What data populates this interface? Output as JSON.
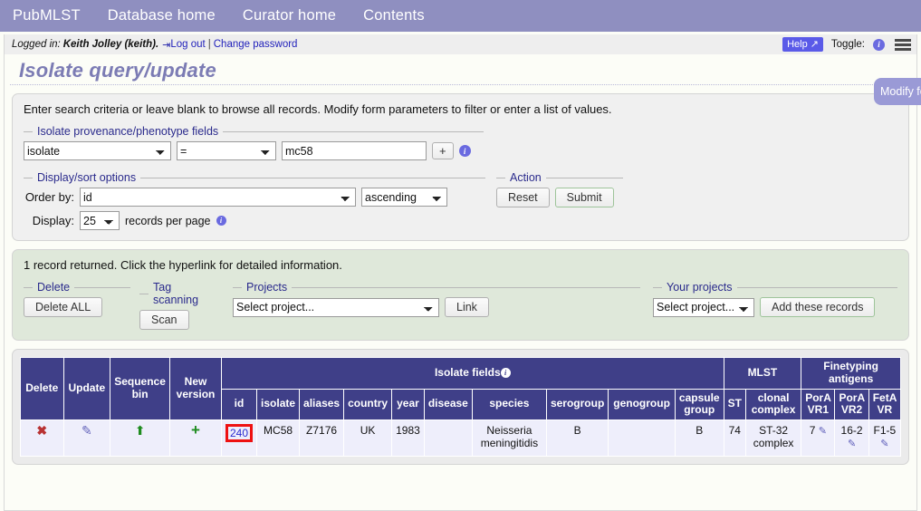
{
  "navbar": {
    "items": [
      {
        "label": "PubMLST"
      },
      {
        "label": "Database home"
      },
      {
        "label": "Curator home"
      },
      {
        "label": "Contents"
      }
    ]
  },
  "loginbar": {
    "prefix": "Logged in:",
    "user": "Keith Jolley (keith).",
    "logout": "Log out",
    "separator": "|",
    "change_password": "Change password",
    "help_label": "Help",
    "help_external_icon": "↗",
    "toggle_label": "Toggle:",
    "info_glyph": "i",
    "menu_icon": "hamburger-icon"
  },
  "page": {
    "title": "Isolate query/update"
  },
  "query_form": {
    "intro": "Enter search criteria or leave blank to browse all records. Modify form parameters to filter or enter a list of values.",
    "provenance": {
      "legend": "Isolate provenance/phenotype fields",
      "field_value": "isolate",
      "operator_value": "=",
      "search_value": "mc58",
      "search_placeholder": "",
      "add_button": "+",
      "info_glyph": "i"
    },
    "display": {
      "legend": "Display/sort options",
      "order_by_label": "Order by:",
      "order_by_value": "id",
      "direction_value": "ascending",
      "display_label": "Display:",
      "display_value": "25",
      "records_per_page": "records per page",
      "info_glyph": "i"
    },
    "action": {
      "legend": "Action",
      "reset_label": "Reset",
      "submit_label": "Submit"
    },
    "side_tab": "Modify form options"
  },
  "results": {
    "summary": "1 record returned. Click the hyperlink for detailed information.",
    "delete": {
      "legend": "Delete",
      "button_label": "Delete ALL"
    },
    "tag_scanning": {
      "legend": "Tag scanning",
      "button_label": "Scan"
    },
    "projects": {
      "legend": "Projects",
      "select_value": "Select project...",
      "link_label": "Link"
    },
    "your_projects": {
      "legend": "Your projects",
      "select_value": "Select project...",
      "button_label": "Add these records"
    }
  },
  "table": {
    "group_headers": {
      "delete": "Delete",
      "update": "Update",
      "sequence_bin": "Sequence bin",
      "new_version": "New version",
      "isolate_fields": "Isolate fields",
      "isolate_fields_info": "i",
      "mlst": "MLST",
      "finetyping": "Finetyping antigens"
    },
    "columns": [
      "id",
      "isolate",
      "aliases",
      "country",
      "year",
      "disease",
      "species",
      "serogroup",
      "genogroup",
      "capsule group",
      "ST",
      "clonal complex",
      "PorA VR1",
      "PorA VR2",
      "FetA VR"
    ],
    "rows": [
      {
        "delete_icon": "red-cross-icon",
        "update_icon": "pencil-icon",
        "sequence_bin_icon": "upload-icon",
        "new_version_icon": "plus-icon",
        "id": "240",
        "isolate": "MC58",
        "aliases": "Z7176",
        "country": "UK",
        "year": "1983",
        "disease": "",
        "species": "Neisseria meningitidis",
        "serogroup": "B",
        "genogroup": "",
        "capsule_group": "B",
        "st": "74",
        "clonal_complex": "ST-32 complex",
        "pora_vr1": "7",
        "pora_vr2": "16-2",
        "feta_vr": "F1-5"
      }
    ]
  },
  "colors": {
    "nav_bg": "#8f8fc0",
    "title": "#7c7cb4",
    "table_header": "#3f3f88",
    "results_panel": "#dfe8da",
    "form_panel": "#f0f0f0",
    "highlight_box": "#ee1111",
    "help_button": "#5a5ae8",
    "side_tab": "#9a9ad6"
  }
}
